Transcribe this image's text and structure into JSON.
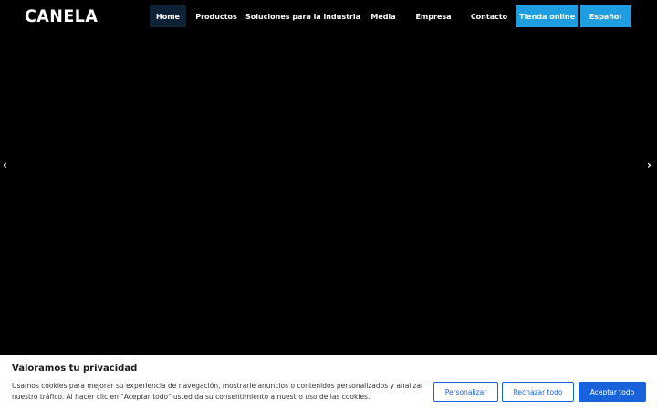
{
  "brand": {
    "logo": "CANELA"
  },
  "nav": {
    "home": "Home",
    "products": "Productos",
    "solutions": "Soluciones para la industria",
    "media": "Media",
    "company": "Empresa",
    "contact": "Contacto",
    "shop": "Tienda online",
    "language": "Español"
  },
  "slider": {
    "prev": "‹",
    "next": "›"
  },
  "cookies": {
    "title": "Valoramos tu privacidad",
    "text": "Usamos cookies para mejorar su experiencia de navegación, mostrarle anuncios o contenidos personalizados y analizar nuestro tráfico. Al hacer clic en \"Aceptar todo\" usted da su consentimiento a nuestro uso de las cookies.",
    "customize": "Personalizar",
    "reject": "Rechazar todo",
    "accept": "Aceptar todo"
  },
  "colors": {
    "accent": "#1e9ee0",
    "active_nav": "#0d2236",
    "cookie_button": "#1863dc"
  }
}
